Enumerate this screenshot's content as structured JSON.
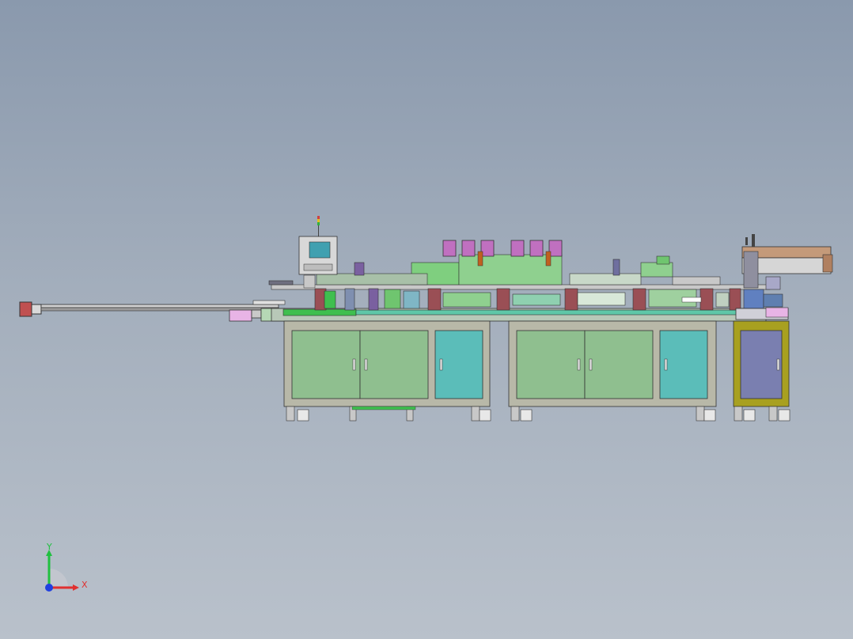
{
  "viewport": {
    "background_top": "#8a99ad",
    "background_bottom": "#b9c1cb"
  },
  "triad": {
    "x_label": "X",
    "y_label": "Y",
    "x_color": "#e03030",
    "y_color": "#20c040",
    "z_color": "#2040e0"
  },
  "colors": {
    "cabinet_green": "#8fbf8f",
    "cabinet_teal": "#5bbdb9",
    "cabinet_purple": "#7a7fb0",
    "cabinet_frame": "#b8b8a8",
    "olive_frame": "#a8a020",
    "magenta_motor": "#c070c0",
    "dark_red_post": "#9a4f55",
    "conveyor_green": "#3fbf4f"
  }
}
